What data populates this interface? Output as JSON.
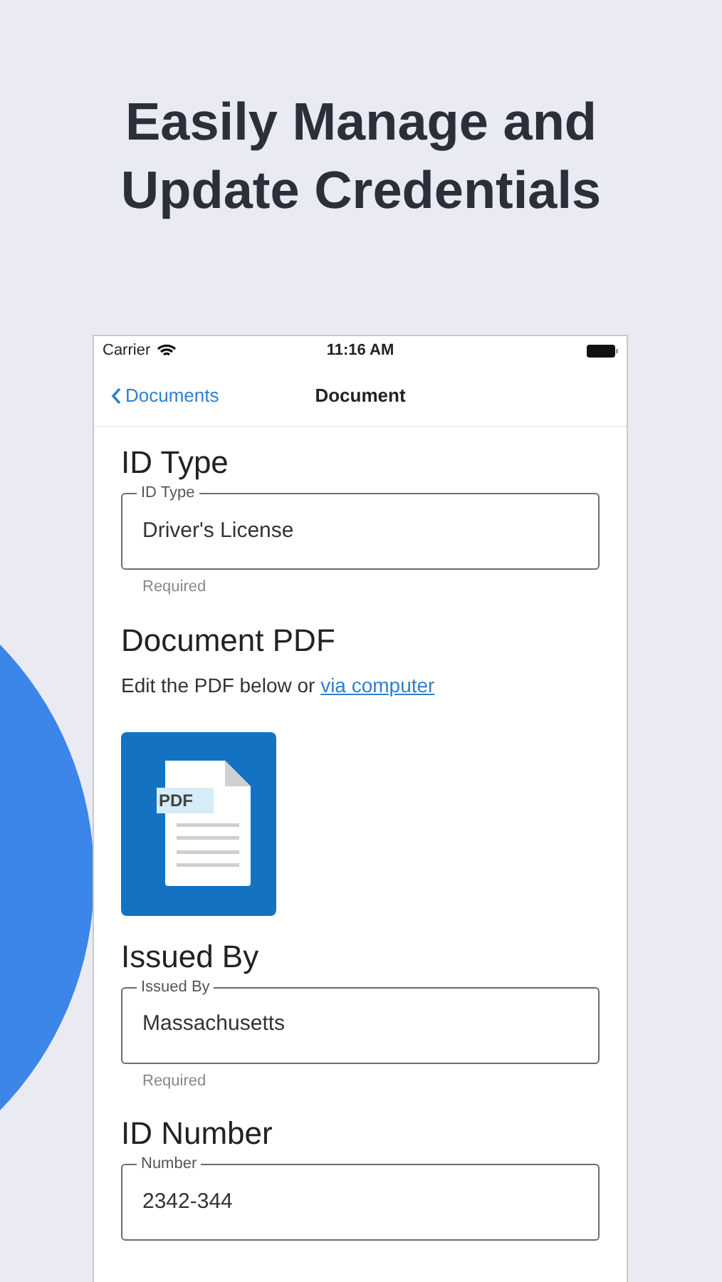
{
  "headline": [
    "Easily Manage and",
    "Update Credentials"
  ],
  "status_bar": {
    "carrier": "Carrier",
    "time": "11:16 AM"
  },
  "nav": {
    "back": "Documents",
    "title": "Document"
  },
  "sections": [
    {
      "kind": "field",
      "heading": "ID Type",
      "label": "ID Type",
      "value": "Driver's License",
      "helper": "Required"
    },
    {
      "kind": "pdf",
      "heading": "Document PDF",
      "text": "Edit the PDF below or",
      "link": "via computer",
      "badge": "PDF"
    },
    {
      "kind": "field",
      "heading": "Issued By",
      "label": "Issued By",
      "value": "Massachusetts",
      "helper": "Required"
    },
    {
      "kind": "field",
      "heading": "ID Number",
      "label": "Number",
      "value": "2342-344"
    }
  ]
}
